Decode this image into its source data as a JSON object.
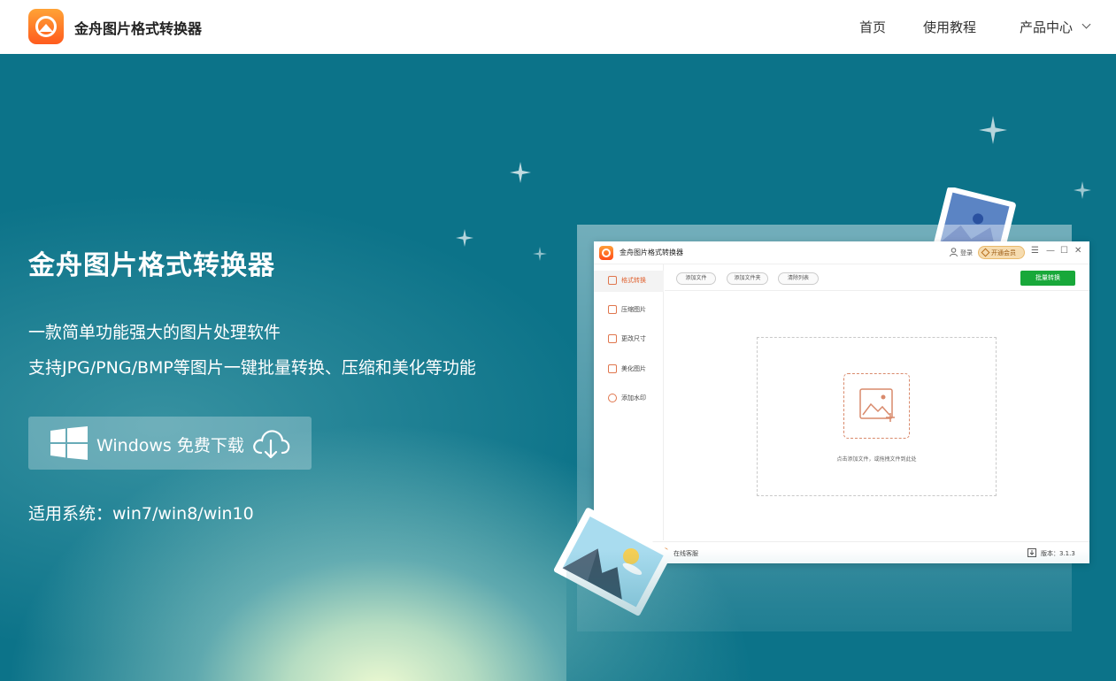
{
  "header": {
    "brand": "金舟图片格式转换器",
    "nav": {
      "home": "首页",
      "tutorial": "使用教程",
      "products": "产品中心"
    }
  },
  "hero": {
    "title": "金舟图片格式转换器",
    "subtitle1": "一款简单功能强大的图片处理软件",
    "subtitle2": "支持JPG/PNG/BMP等图片一键批量转换、压缩和美化等功能",
    "download_label": "Windows 免费下载",
    "compat": "适用系统：win7/win8/win10"
  },
  "app": {
    "title": "金舟图片格式转换器",
    "login": "登录",
    "vip": "开通会员",
    "window_controls": [
      "☰",
      "—",
      "☐",
      "✕"
    ],
    "sidebar": [
      "格式转换",
      "压缩图片",
      "更改尺寸",
      "美化图片",
      "添加水印"
    ],
    "toolbar": {
      "add_file": "添加文件",
      "add_folder": "添加文件夹",
      "clear_list": "清除列表",
      "batch": "批量转换"
    },
    "drop_text": "点击添加文件，或拖拽文件到此处",
    "support": "在线客服",
    "version": "版本：3.1.3"
  },
  "colors": {
    "hero_bg": "#0c7389",
    "accent": "#ff6a25",
    "batch_button": "#18a83a"
  }
}
